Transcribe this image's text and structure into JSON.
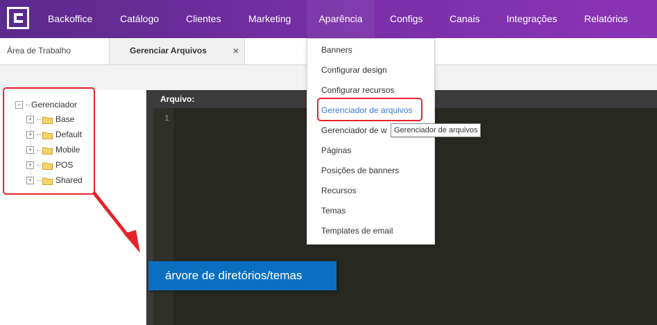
{
  "brand": {
    "logo_icon": "c-logo-icon",
    "logo_color": "#ffffff"
  },
  "nav": {
    "items": [
      {
        "label": "Backoffice"
      },
      {
        "label": "Catálogo"
      },
      {
        "label": "Clientes"
      },
      {
        "label": "Marketing"
      },
      {
        "label": "Aparência"
      },
      {
        "label": "Configs"
      },
      {
        "label": "Canais"
      },
      {
        "label": "Integrações"
      },
      {
        "label": "Relatórios"
      }
    ],
    "active": "Aparência",
    "colors": {
      "gradient_start": "#5a2a8c",
      "gradient_end": "#8a34b5"
    }
  },
  "tabs": {
    "items": [
      {
        "label": "Área de Trabalho"
      },
      {
        "label": "Gerenciar Arquivos"
      }
    ],
    "active": "Gerenciar Arquivos",
    "close_symbol": "×"
  },
  "tree": {
    "root": {
      "label": "Gerenciador",
      "toggle": "−"
    },
    "nodes": [
      {
        "label": "Base",
        "toggle": "+"
      },
      {
        "label": "Default",
        "toggle": "+"
      },
      {
        "label": "Mobile",
        "toggle": "+"
      },
      {
        "label": "POS",
        "toggle": "+"
      },
      {
        "label": "Shared",
        "toggle": "+"
      }
    ],
    "folder_icon": "folder-icon"
  },
  "editor": {
    "title": "Arquivo:",
    "line_numbers": [
      "1"
    ]
  },
  "dropdown": {
    "items": [
      {
        "label": "Banners"
      },
      {
        "label": "Configurar design"
      },
      {
        "label": "Configurar recursos"
      },
      {
        "label": "Gerenciador de arquivos"
      },
      {
        "label": "Gerenciador de w"
      },
      {
        "label": "Páginas"
      },
      {
        "label": "Posições de banners"
      },
      {
        "label": "Recursos"
      },
      {
        "label": "Temas"
      },
      {
        "label": "Templates de email"
      }
    ],
    "highlighted": "Gerenciador de arquivos",
    "highlight_color": "#3a7ccf"
  },
  "tooltip": {
    "text": "Gerenciador de arquivos"
  },
  "annotation": {
    "callout_text": "árvore de diretórios/temas",
    "callout_color": "#0b6fc1",
    "highlight_color": "#e3242b"
  }
}
